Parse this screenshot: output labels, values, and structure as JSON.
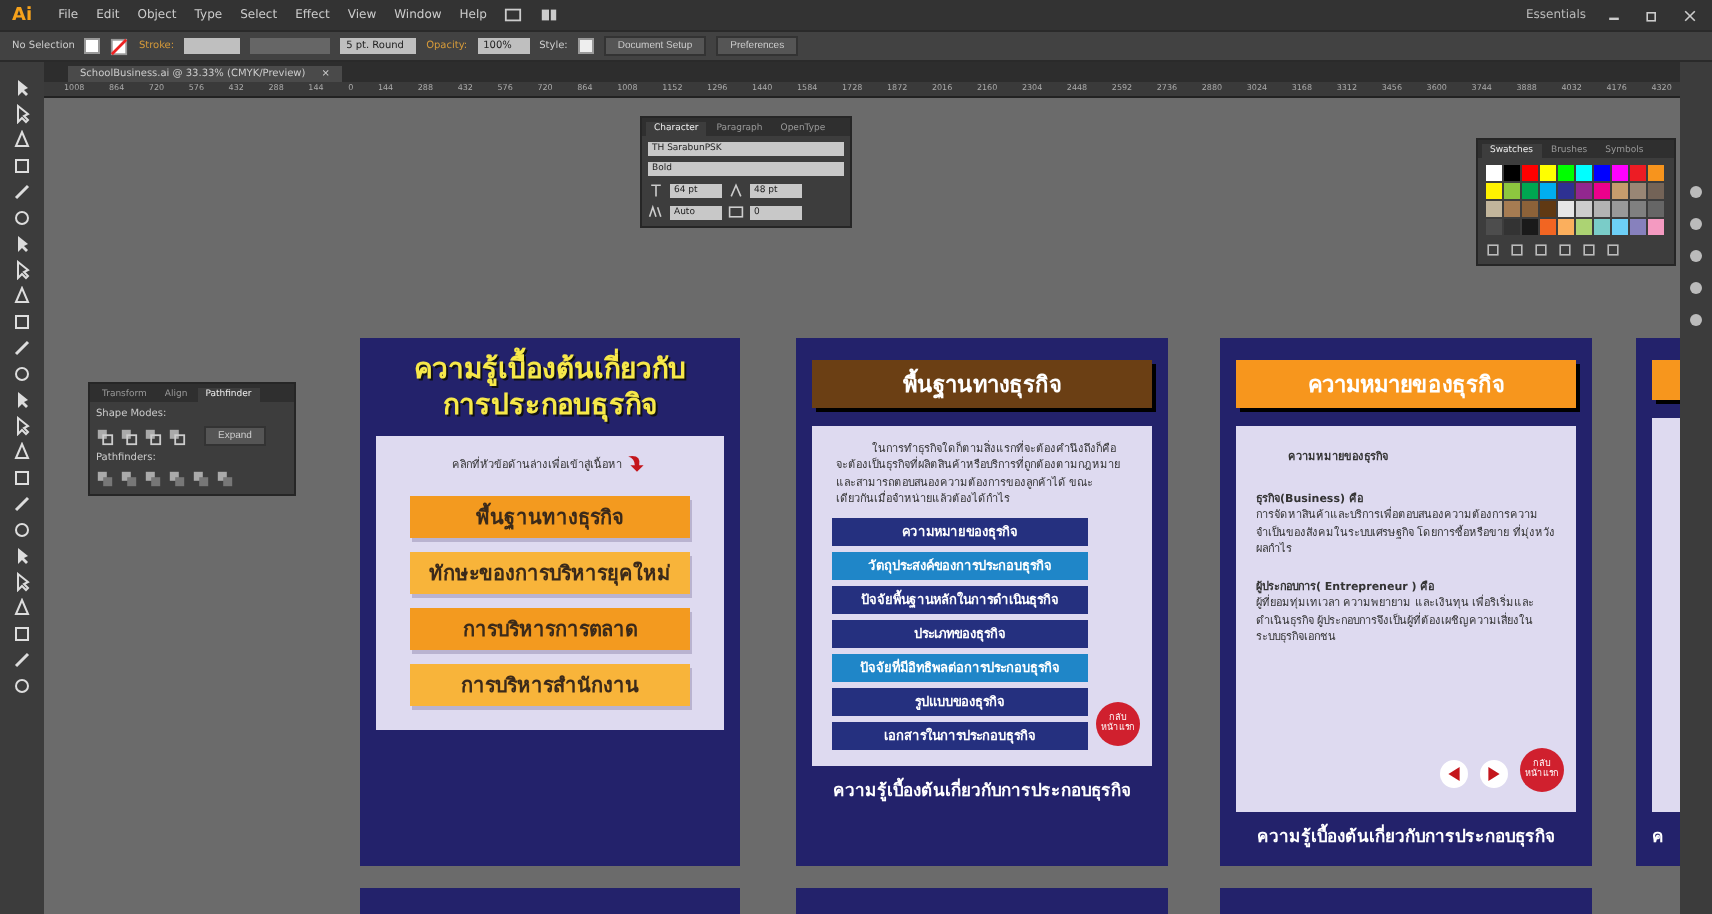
{
  "app": {
    "logo": "Ai",
    "menu": [
      "File",
      "Edit",
      "Object",
      "Type",
      "Select",
      "Effect",
      "View",
      "Window",
      "Help"
    ],
    "workspace": "Essentials"
  },
  "control_bar": {
    "selection": "No Selection",
    "stroke_label": "Stroke:",
    "brush": "5 pt. Round",
    "opacity_label": "Opacity:",
    "opacity": "100%",
    "style_label": "Style:",
    "buttons": [
      "Document Setup",
      "Preferences"
    ]
  },
  "document_tab": {
    "title": "SchoolBusiness.ai @ 33.33% (CMYK/Preview)",
    "close": "×"
  },
  "ruler": {
    "ticks": [
      "1008",
      "864",
      "720",
      "576",
      "432",
      "288",
      "144",
      "0",
      "144",
      "288",
      "432",
      "576",
      "720",
      "864",
      "1008",
      "1152",
      "1296",
      "1440",
      "1584",
      "1728",
      "1872",
      "2016",
      "2160",
      "2304",
      "2448",
      "2592",
      "2736",
      "2880",
      "3024",
      "3168",
      "3312",
      "3456",
      "3600",
      "3744",
      "3888",
      "4032",
      "4176",
      "4320"
    ]
  },
  "panels": {
    "character": {
      "tabs": [
        {
          "label": "Character",
          "selected": true
        },
        {
          "label": "Paragraph",
          "selected": false
        },
        {
          "label": "OpenType",
          "selected": false
        }
      ],
      "font": "TH SarabunPSK",
      "style": "Bold",
      "size": "64 pt",
      "leading": "48 pt",
      "kerning": "Auto",
      "tracking": "0"
    },
    "pathfinder": {
      "tabs": [
        {
          "label": "Transform",
          "selected": false
        },
        {
          "label": "Align",
          "selected": false
        },
        {
          "label": "Pathfinder",
          "selected": true
        }
      ],
      "shape_modes": "Shape Modes:",
      "expand": "Expand",
      "pathfinders": "Pathfinders:"
    },
    "swatches": {
      "tabs": [
        {
          "label": "Swatches",
          "selected": true
        },
        {
          "label": "Brushes",
          "selected": false
        },
        {
          "label": "Symbols",
          "selected": false
        }
      ]
    }
  },
  "artboards": [
    {
      "kind": "menu",
      "title": "ความรู้เบื้องต้นเกี่ยวกับ\nการประกอบธุรกิจ",
      "hint": "คลิกที่หัวข้อด้านล่างเพื่อเข้าสู่เนื้อหา",
      "buttons": [
        {
          "label": "พื้นฐานทางธุรกิจ",
          "color": "#f39a1f"
        },
        {
          "label": "ทักษะของการบริหารยุคใหม่",
          "color": "#f8b43a"
        },
        {
          "label": "การบริหารการตลาด",
          "color": "#f39a1f"
        },
        {
          "label": "การบริหารสำนักงาน",
          "color": "#f8b43a"
        }
      ]
    },
    {
      "kind": "topics",
      "header": {
        "text": "พื้นฐานทางธุรกิจ",
        "color": "#6b3f14"
      },
      "paragraph": "ในการทำธุรกิจใดก็ตามสิ่งแรกที่จะต้องคำนึงถึงก็คือ จะต้องเป็นธุรกิจที่ผลิตสินค้าหรือบริการที่ถูกต้องตามกฎหมาย และสามารถตอบสนองความต้องการของลูกค้าได้ ขณะเดียวกันเมื่อจำหน่ายแล้วต้องได้กำไร",
      "buttons": [
        {
          "label": "ความหมายของธุรกิจ",
          "color": "#25307f"
        },
        {
          "label": "วัตถุประสงค์ของการประกอบธุรกิจ",
          "color": "#1f86c8"
        },
        {
          "label": "ปัจจัยพื้นฐานหลักในการดำเนินธุรกิจ",
          "color": "#25307f"
        },
        {
          "label": "ประเภทของธุรกิจ",
          "color": "#25307f"
        },
        {
          "label": "ปัจจัยที่มีอิทธิพลต่อการประกอบธุรกิจ",
          "color": "#1f86c8"
        },
        {
          "label": "รูปแบบของธุรกิจ",
          "color": "#25307f"
        },
        {
          "label": "เอกสารในการประกอบธุรกิจ",
          "color": "#25307f"
        }
      ],
      "home": "กลับ หน้าแรก",
      "footer": "ความรู้เบื้องต้นเกี่ยวกับการประกอบธุรกิจ"
    },
    {
      "kind": "content",
      "header": {
        "text": "ความหมายของธุรกิจ",
        "color": "#f7961d"
      },
      "heading": "ความหมายของธุรกิจ",
      "sections": [
        {
          "term": "ธุรกิจ(Business) คือ",
          "text": "การจัดหาสินค้าและบริการเพื่อตอบสนองความต้องการความจำเป็นของสังคมในระบบเศรษฐกิจ โดยการซื้อหรือขาย ที่มุ่งหวังผลกำไร"
        },
        {
          "term": "ผู้ประกอบการ( Entrepreneur ) คือ",
          "text": "ผู้ที่ยอมทุ่มเทเวลา ความพยายาม และเงินทุน เพื่อริเริ่มและดำเนินธุรกิจ ผู้ประกอบการจึงเป็นผู้ที่ต้องเผชิญความเสี่ยงในระบบธุรกิจเอกชน"
        }
      ],
      "home": "กลับ หน้าแรก",
      "footer": "ความรู้เบื้องต้นเกี่ยวกับการประกอบธุรกิจ"
    },
    {
      "kind": "partial",
      "header": {
        "color": "#f7961d"
      },
      "footer": "ค"
    }
  ]
}
